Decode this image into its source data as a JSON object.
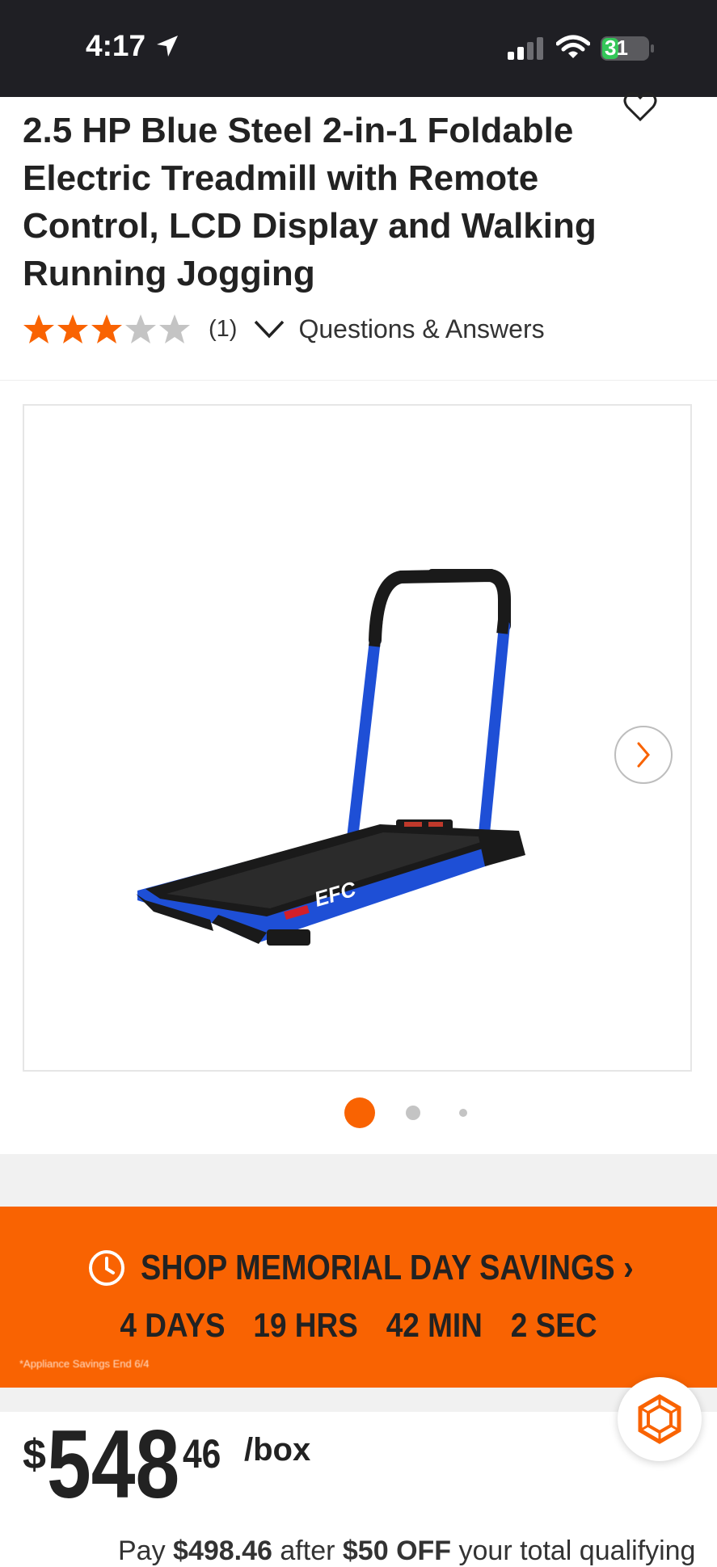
{
  "status_bar": {
    "time": "4:17",
    "battery": "31"
  },
  "product": {
    "title": "2.5 HP Blue Steel 2-in-1 Foldable Electric Treadmill with Remote Control, LCD Display and Walking Running Jogging",
    "rating": 3,
    "rating_max": 5,
    "review_count": "(1)",
    "qa_label": "Questions & Answers"
  },
  "gallery": {
    "image_count": 3,
    "active_index": 0,
    "brand_mark": "EFC"
  },
  "promo": {
    "title": "SHOP MEMORIAL DAY SAVINGS ›",
    "countdown": [
      "4 DAYS",
      "19 HRS",
      "42 MIN",
      "2 SEC"
    ],
    "note": "*Appliance Savings End 6/4"
  },
  "price": {
    "currency": "$",
    "dollars": "548",
    "cents": "46",
    "unit": "/box",
    "pay_prefix": "Pay ",
    "pay_amount": "$498.46",
    "pay_mid": " after ",
    "pay_discount": "$50 OFF",
    "pay_suffix": " your total qualifying"
  },
  "colors": {
    "accent": "#f96302",
    "status_bar": "#1f1f24",
    "star_empty": "#c4c4c4"
  },
  "icons": [
    "location-arrow-icon",
    "signal-icon",
    "wifi-icon",
    "battery-icon",
    "heart-icon",
    "star-icon",
    "chevron-down-icon",
    "chevron-right-icon",
    "clock-icon",
    "chat-icon"
  ]
}
